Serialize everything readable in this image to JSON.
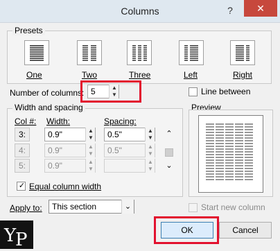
{
  "window": {
    "title": "Columns",
    "help_label": "?",
    "close_label": "✕"
  },
  "presets": {
    "group_label": "Presets",
    "items": [
      {
        "label": "One",
        "columns": 1
      },
      {
        "label": "Two",
        "columns": 2
      },
      {
        "label": "Three",
        "columns": 3
      },
      {
        "label": "Left",
        "columns": 2
      },
      {
        "label": "Right",
        "columns": 2
      }
    ]
  },
  "number_of_columns": {
    "label": "Number of columns:",
    "value": "5"
  },
  "line_between": {
    "label": "Line between",
    "checked": false
  },
  "width_spacing": {
    "group_label": "Width and spacing",
    "headers": {
      "col": "Col #:",
      "width": "Width:",
      "spacing": "Spacing:"
    },
    "rows": [
      {
        "col": "3:",
        "width": "0.9\"",
        "spacing": "0.5\"",
        "enabled": true
      },
      {
        "col": "4:",
        "width": "0.9\"",
        "spacing": "0.5\"",
        "enabled": false
      },
      {
        "col": "5:",
        "width": "0.9\"",
        "spacing": "",
        "enabled": false
      }
    ],
    "equal_width_label": "Equal column width",
    "equal_width_checked": true
  },
  "preview": {
    "label": "Preview"
  },
  "apply_to": {
    "label": "Apply to:",
    "value": "This section"
  },
  "start_new_column": {
    "label": "Start new column",
    "checked": false
  },
  "buttons": {
    "ok": "OK",
    "cancel": "Cancel"
  },
  "watermark": {
    "text": "YP"
  },
  "colors": {
    "highlight": "#e2112e",
    "close": "#c7483d",
    "ok_border": "#3c7fb1"
  }
}
